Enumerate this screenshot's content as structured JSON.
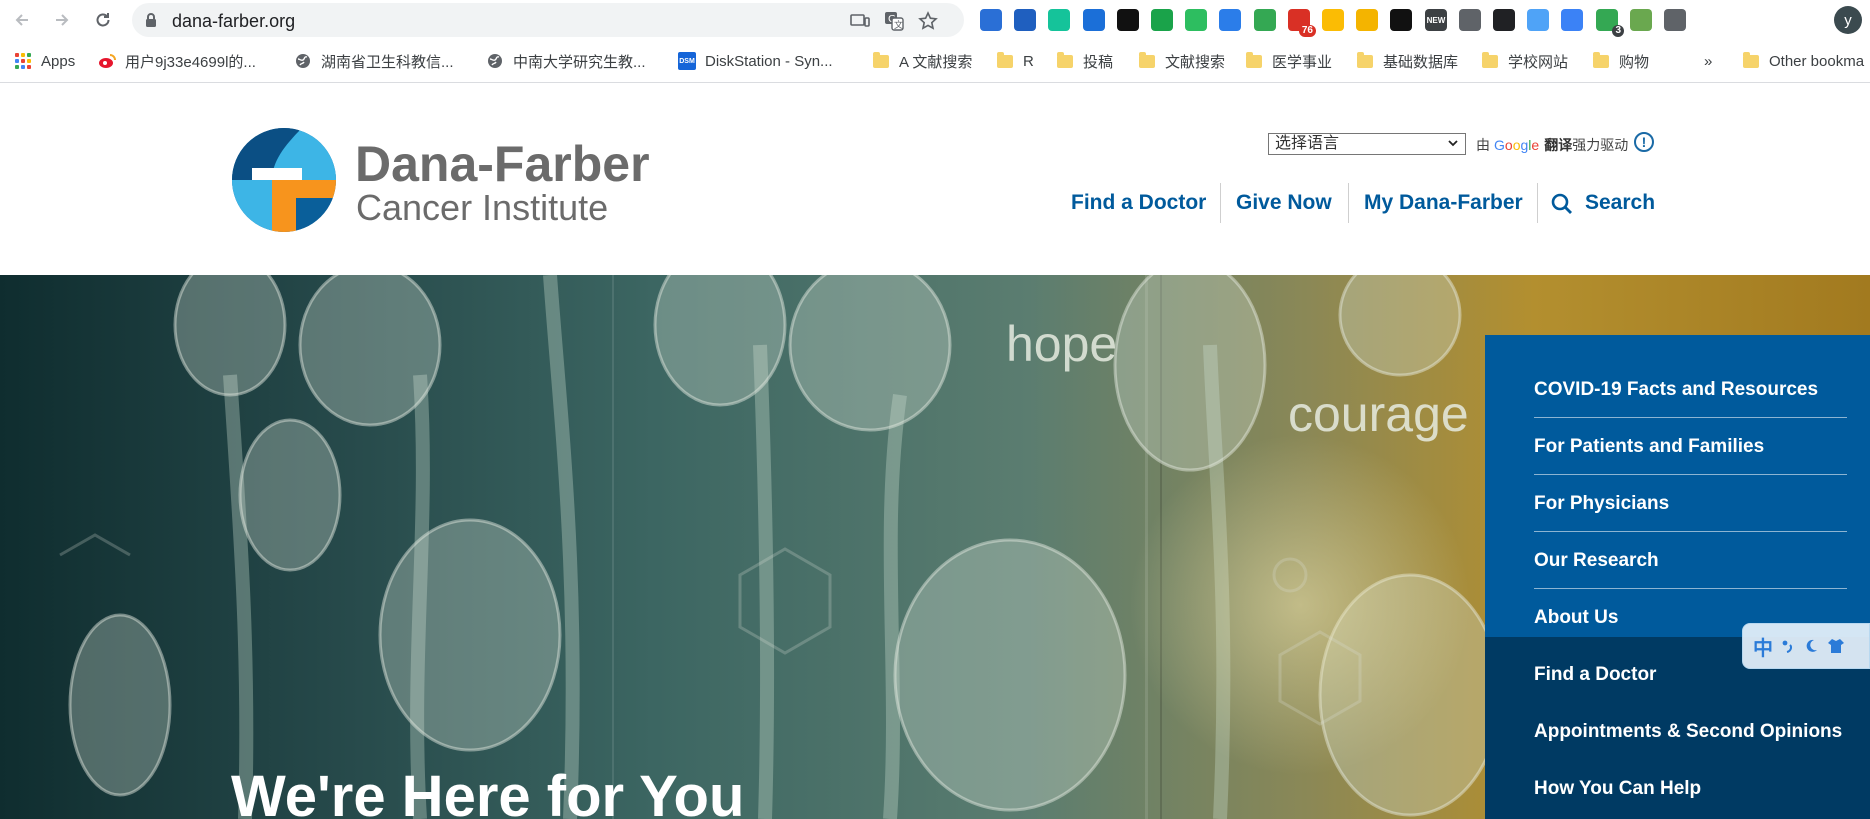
{
  "browser": {
    "url": "dana-farber.org",
    "extensions": [
      {
        "icon": "graduation-cap-icon",
        "color": "#2a6fd6"
      },
      {
        "icon": "microscope-icon",
        "color": "#1f5fbf"
      },
      {
        "icon": "grammarly-icon",
        "color": "#15c39a"
      },
      {
        "icon": "camera-icon",
        "color": "#1b6fd8"
      },
      {
        "icon": "notion-like-icon",
        "color": "#111111"
      },
      {
        "icon": "green-leaf-icon",
        "color": "#1aa34a"
      },
      {
        "icon": "evernote-icon",
        "color": "#2dbe60"
      },
      {
        "icon": "pen-icon",
        "color": "#2b7de9"
      },
      {
        "icon": "chart-check-icon",
        "color": "#34a853"
      },
      {
        "icon": "mail-icon",
        "color": "#d93025",
        "badge": "76"
      },
      {
        "icon": "color-ring-icon",
        "color": "#fbbc04"
      },
      {
        "icon": "dots-icon",
        "color": "#f4b400"
      },
      {
        "icon": "box-icon",
        "color": "#111111"
      },
      {
        "icon": "new-icon",
        "color": "#3c4043",
        "label": "NEW"
      },
      {
        "icon": "globe-icon",
        "color": "#5f6368"
      },
      {
        "icon": "fish-icon",
        "color": "#202124"
      },
      {
        "icon": "check-icon",
        "color": "#4fa3f7"
      },
      {
        "icon": "cloud-icon",
        "color": "#3b82f6"
      },
      {
        "icon": "shield-icon",
        "color": "#34a853",
        "badge": "3"
      },
      {
        "icon": "earth-icon",
        "color": "#6aa84f"
      },
      {
        "icon": "refresh-g-icon",
        "color": "#5f6368"
      }
    ],
    "profile_initial": "y",
    "bookmarks": [
      {
        "label": "Apps",
        "icon": "apps-icon"
      },
      {
        "label": "用户9j33e4699l的...",
        "icon": "weibo-icon"
      },
      {
        "label": "湖南省卫生科教信...",
        "icon": "globe-icon"
      },
      {
        "label": "中南大学研究生教...",
        "icon": "globe-icon"
      },
      {
        "label": "DiskStation - Syn...",
        "icon": "dsm-icon",
        "icon_text": "DSM"
      },
      {
        "label": "A 文献搜索",
        "icon": "folder-icon"
      },
      {
        "label": "R",
        "icon": "folder-icon"
      },
      {
        "label": "投稿",
        "icon": "folder-icon"
      },
      {
        "label": "文献搜索",
        "icon": "folder-icon"
      },
      {
        "label": "医学事业",
        "icon": "folder-icon"
      },
      {
        "label": "基础数据库",
        "icon": "folder-icon"
      },
      {
        "label": "学校网站",
        "icon": "folder-icon"
      },
      {
        "label": "购物",
        "icon": "folder-icon"
      }
    ],
    "more_bookmarks": "»",
    "other_bookmarks": "Other bookma"
  },
  "site": {
    "brand_name": "Dana-Farber",
    "brand_sub": "Cancer Institute",
    "language_select": "选择语言",
    "translate_prefix": "由",
    "translate_google": "Google",
    "translate_bold": "翻译",
    "translate_suffix": "强力驱动",
    "info_symbol": "!",
    "nav": [
      "Find a Doctor",
      "Give Now",
      "My Dana-Farber",
      "Search"
    ],
    "colors": {
      "primary": "#005a9c",
      "secondary": "#003a63",
      "logo_orange": "#f7941d",
      "logo_light": "#3db5e6"
    }
  },
  "hero": {
    "words": [
      "hope",
      "courage"
    ],
    "title": "We're Here for You",
    "menu_primary": [
      "COVID-19 Facts and Resources",
      "For Patients and Families",
      "For Physicians",
      "Our Research",
      "About Us"
    ],
    "menu_secondary": [
      "Find a Doctor",
      "Appointments & Second Opinions",
      "How You Can Help"
    ],
    "ime_label": "中"
  }
}
